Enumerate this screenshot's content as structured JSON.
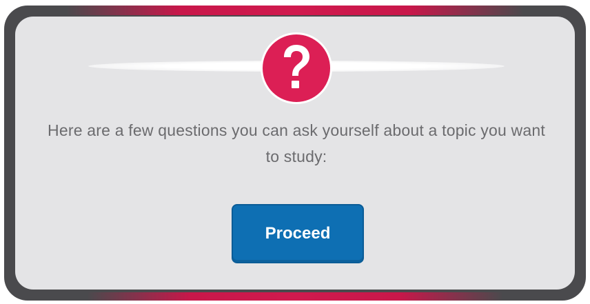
{
  "dialog": {
    "icon": "question-mark-icon",
    "message": "Here are a few questions you can ask yourself about a topic you want to study:",
    "proceed_label": "Proceed"
  },
  "colors": {
    "frame": "#4a4a4d",
    "accent": "#d01a4e",
    "panel": "#e4e4e6",
    "icon_background": "#dc1f55",
    "button": "#0e6fb3",
    "message_text": "#6b6b6e"
  }
}
